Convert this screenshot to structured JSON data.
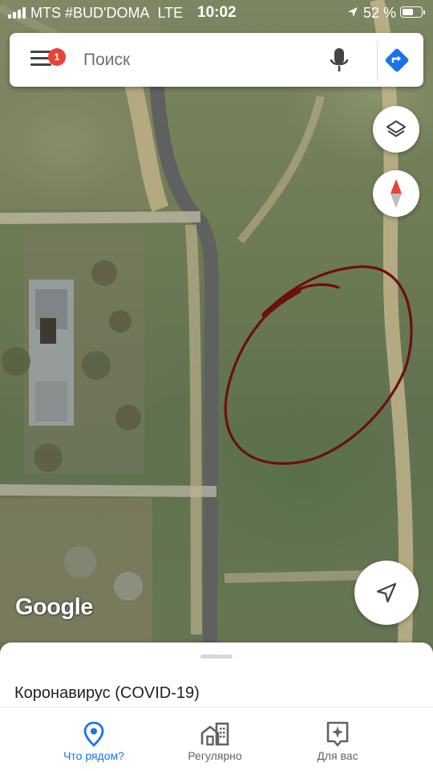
{
  "status_bar": {
    "carrier": "MTS #BUD'DOMA",
    "network": "LTE",
    "time": "10:02",
    "battery_percent": "52 %",
    "battery_level": 0.52
  },
  "search": {
    "placeholder": "Поиск",
    "notification_count": "1",
    "icons": [
      "menu-icon",
      "mic-icon",
      "directions-icon"
    ]
  },
  "map": {
    "attribution": "Google",
    "annotation_color": "#6b0f0f",
    "controls": [
      "layers-icon",
      "compass-icon",
      "my-location-icon"
    ]
  },
  "sheet": {
    "title": "Коронавирус (COVID-19)"
  },
  "tabs": [
    {
      "label": "Что рядом?",
      "icon": "explore-pin-icon",
      "active": true
    },
    {
      "label": "Регулярно",
      "icon": "commute-icon",
      "active": false
    },
    {
      "label": "Для вас",
      "icon": "for-you-icon",
      "active": false
    }
  ],
  "colors": {
    "accent": "#1a73e8",
    "badge": "#ea4335",
    "compass_red": "#ea4335"
  }
}
